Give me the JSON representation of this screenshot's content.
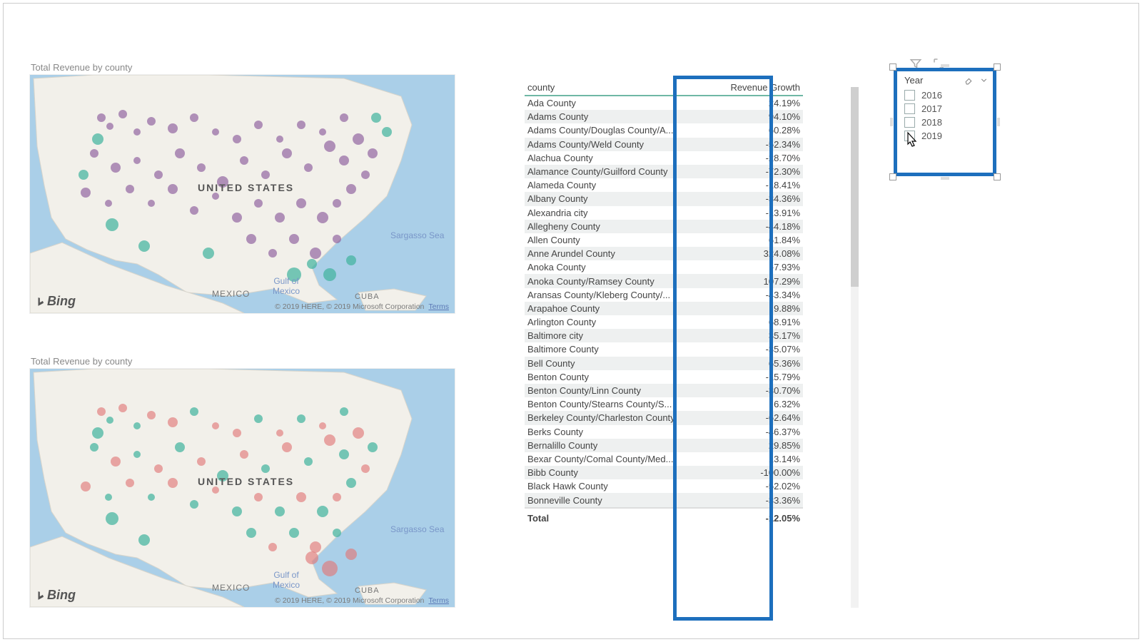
{
  "map1": {
    "title": "Total Revenue by county"
  },
  "map2": {
    "title": "Total Revenue by county"
  },
  "map_labels": {
    "country": "UNITED STATES",
    "mexico": "MEXICO",
    "cuba": "CUBA",
    "gulf": "Gulf of\nMexico",
    "sargasso": "Sargasso Sea"
  },
  "map_footer": {
    "logo": "Bing",
    "copyright": "© 2019 HERE, © 2019 Microsoft Corporation",
    "terms": "Terms"
  },
  "table": {
    "headers": {
      "county": "county",
      "growth": "Revenue Growth"
    },
    "rows": [
      {
        "county": "Ada County",
        "growth": "24.19%"
      },
      {
        "county": "Adams County",
        "growth": "94.10%"
      },
      {
        "county": "Adams County/Douglas County/A...",
        "growth": "60.28%"
      },
      {
        "county": "Adams County/Weld County",
        "growth": "-52.34%"
      },
      {
        "county": "Alachua County",
        "growth": "-28.70%"
      },
      {
        "county": "Alamance County/Guilford County",
        "growth": "-72.30%"
      },
      {
        "county": "Alameda County",
        "growth": "-18.41%"
      },
      {
        "county": "Albany County",
        "growth": "-34.36%"
      },
      {
        "county": "Alexandria city",
        "growth": "-13.91%"
      },
      {
        "county": "Allegheny County",
        "growth": "-44.18%"
      },
      {
        "county": "Allen County",
        "growth": "61.84%"
      },
      {
        "county": "Anne Arundel County",
        "growth": "324.08%"
      },
      {
        "county": "Anoka County",
        "growth": "-7.93%"
      },
      {
        "county": "Anoka County/Ramsey County",
        "growth": "107.29%"
      },
      {
        "county": "Aransas County/Kleberg County/...",
        "growth": "-43.34%"
      },
      {
        "county": "Arapahoe County",
        "growth": "9.88%"
      },
      {
        "county": "Arlington County",
        "growth": "68.91%"
      },
      {
        "county": "Baltimore city",
        "growth": "35.17%"
      },
      {
        "county": "Baltimore County",
        "growth": "-35.07%"
      },
      {
        "county": "Bell County",
        "growth": "65.36%"
      },
      {
        "county": "Benton County",
        "growth": "-15.79%"
      },
      {
        "county": "Benton County/Linn County",
        "growth": "-30.70%"
      },
      {
        "county": "Benton County/Stearns County/S...",
        "growth": "6.32%"
      },
      {
        "county": "Berkeley County/Charleston County",
        "growth": "-62.64%"
      },
      {
        "county": "Berks County",
        "growth": "-46.37%"
      },
      {
        "county": "Bernalillo County",
        "growth": "29.85%"
      },
      {
        "county": "Bexar County/Comal County/Med...",
        "growth": "13.14%"
      },
      {
        "county": "Bibb County",
        "growth": "-100.00%"
      },
      {
        "county": "Black Hawk County",
        "growth": "-52.02%"
      },
      {
        "county": "Bonneville County",
        "growth": "-33.36%"
      }
    ],
    "total": {
      "label": "Total",
      "growth": "-12.05%"
    }
  },
  "slicer": {
    "title": "Year",
    "items": [
      "2016",
      "2017",
      "2018",
      "2019"
    ]
  }
}
